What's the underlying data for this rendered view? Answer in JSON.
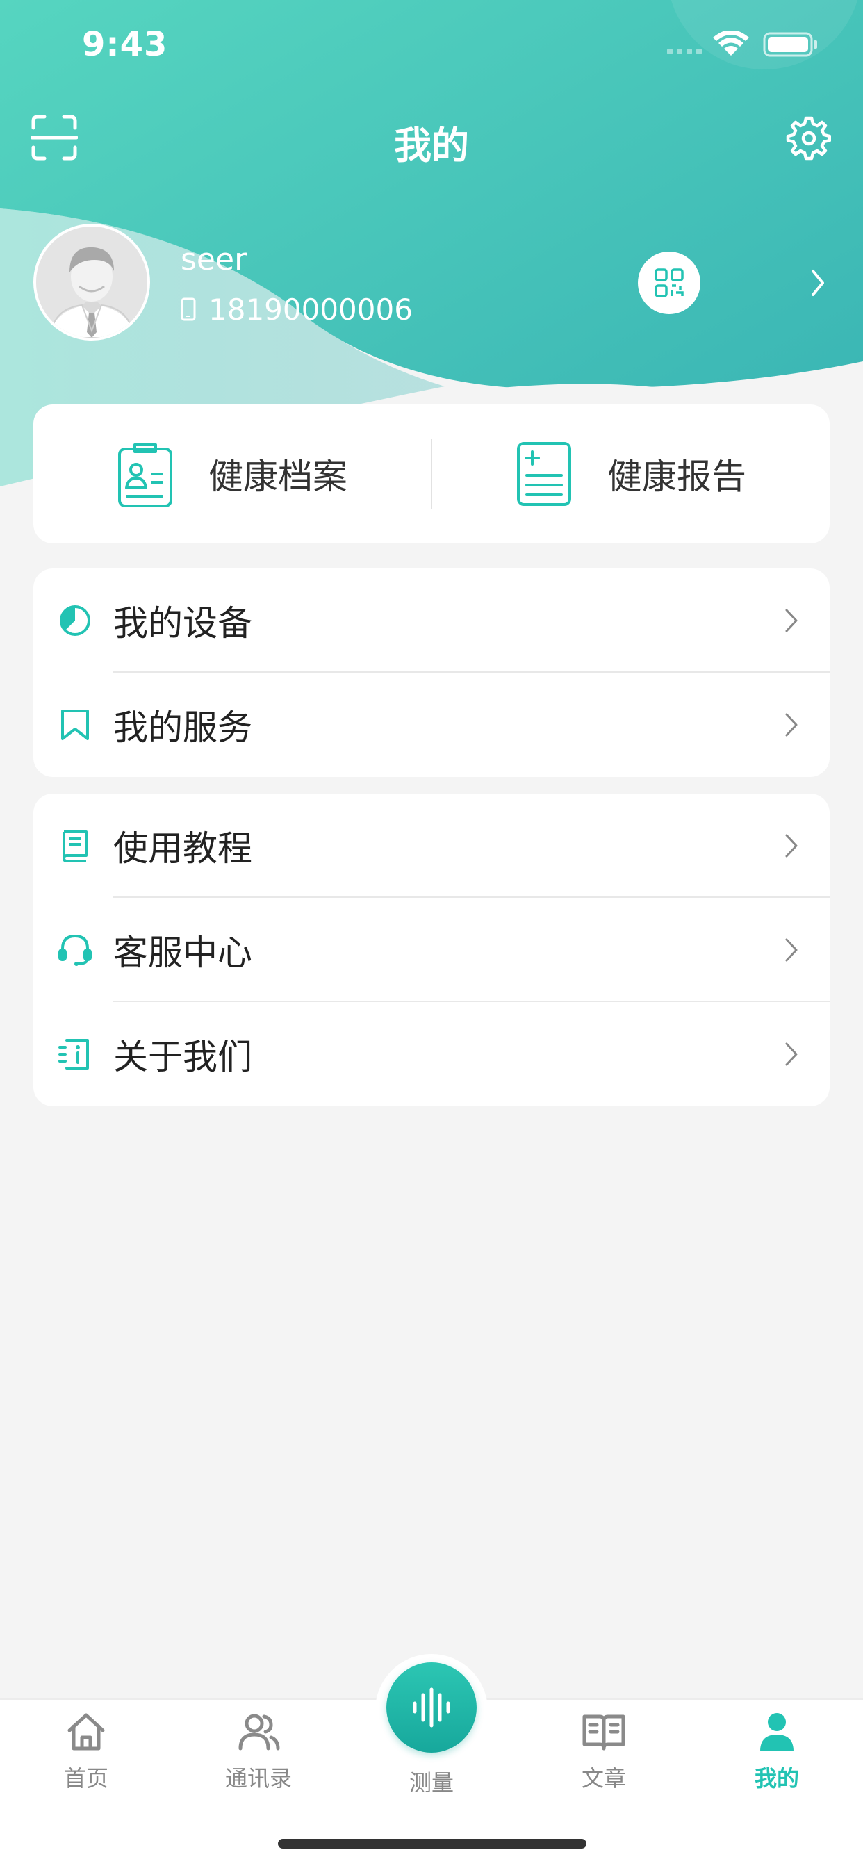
{
  "status_bar": {
    "time": "9:43"
  },
  "nav": {
    "title": "我的"
  },
  "profile": {
    "name": "seer",
    "phone": "18190000006"
  },
  "quick_actions": [
    {
      "label": "健康档案",
      "icon": "health-record-icon"
    },
    {
      "label": "健康报告",
      "icon": "health-report-icon"
    }
  ],
  "menu_group_1": [
    {
      "label": "我的设备",
      "icon": "device-icon"
    },
    {
      "label": "我的服务",
      "icon": "bookmark-icon"
    }
  ],
  "menu_group_2": [
    {
      "label": "使用教程",
      "icon": "book-icon"
    },
    {
      "label": "客服中心",
      "icon": "headset-icon"
    },
    {
      "label": "关于我们",
      "icon": "info-icon"
    }
  ],
  "tabs": [
    {
      "label": "首页",
      "icon": "home-icon"
    },
    {
      "label": "通讯录",
      "icon": "contacts-icon"
    },
    {
      "label": "测量",
      "icon": "sound-wave-icon"
    },
    {
      "label": "文章",
      "icon": "open-book-icon"
    },
    {
      "label": "我的",
      "icon": "person-icon",
      "active": true
    }
  ],
  "colors": {
    "accent": "#22c3b3",
    "header_start": "#52d3bf",
    "header_end": "#3bb5b5"
  }
}
